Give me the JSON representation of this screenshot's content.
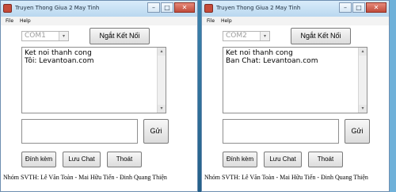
{
  "windows": [
    {
      "title": "Truyen Thong Giua 2 May Tinh",
      "menu": [
        "File",
        "Help"
      ],
      "com_port": "COM1",
      "connect_label": "Ngắt Kết Nối",
      "chat_lines": [
        "Ket noi thanh cong",
        "Tôi: Levantoan.com"
      ],
      "send_label": "Gửi",
      "attach_label": "Đính kèm",
      "save_label": "Lưu Chat",
      "exit_label": "Thoát",
      "footer": "Nhóm SVTH: Lê Văn Toàn - Mai Hữu Tiến - Đinh Quang Thiện"
    },
    {
      "title": "Truyen Thong Giua 2 May Tinh",
      "menu": [
        "File",
        "Help"
      ],
      "com_port": "COM2",
      "connect_label": "Ngắt Kết Nối",
      "chat_lines": [
        "Ket noi thanh cong",
        "Ban Chat: Levantoan.com"
      ],
      "send_label": "Gửi",
      "attach_label": "Đính kèm",
      "save_label": "Lưu Chat",
      "exit_label": "Thoát",
      "footer": "Nhóm SVTH: Lê Văn Toàn - Mai Hữu Tiến - Đinh Quang Thiện"
    }
  ],
  "window_controls": {
    "minimize": "–",
    "maximize": "□",
    "close": "✕"
  },
  "icons": {
    "dropdown": "▾",
    "scroll_up": "▴",
    "scroll_down": "▾"
  }
}
